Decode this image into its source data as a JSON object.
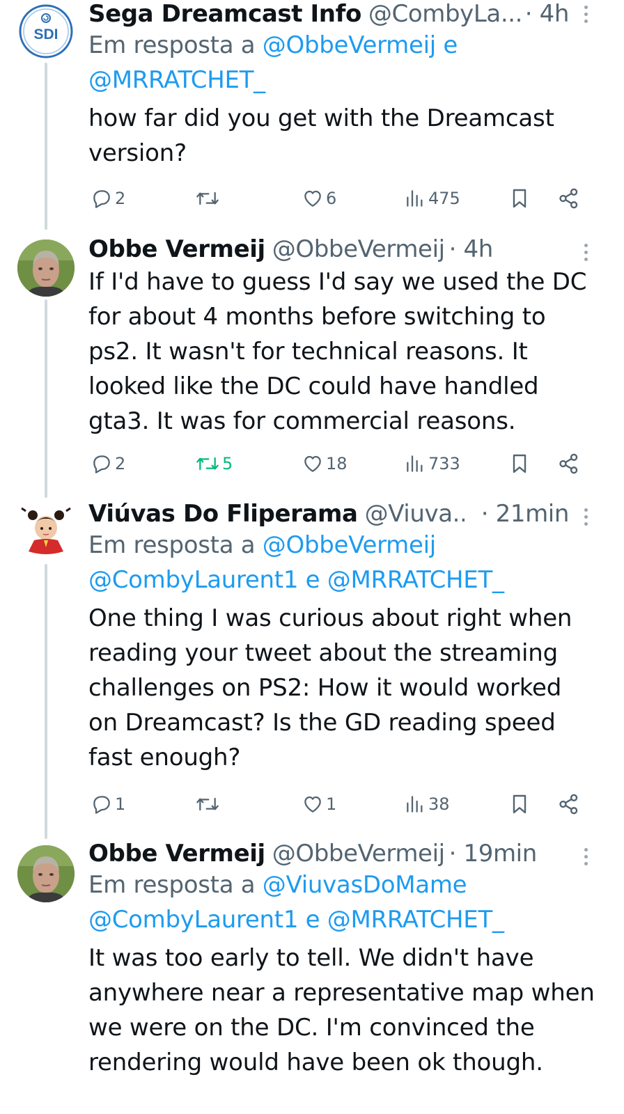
{
  "tweets": [
    {
      "name": "Sega Dreamcast Info",
      "handle": "@CombyLa...",
      "time": "· 4h",
      "avatar": "sdi-logo",
      "reply_prefix": "Em resposta a ",
      "reply_mention_1": "@ObbeVermeij",
      "reply_sep_1": " e",
      "reply_mention_2": "@MRRATCHET_",
      "reply_sep_2": "",
      "reply_mention_3": "",
      "text": "how far did you get with the Dreamcast\nversion?",
      "replies": "2",
      "retweets": "",
      "likes": "6",
      "views": "475"
    },
    {
      "name": "Obbe Vermeij",
      "handle": "@ObbeVermeij",
      "time": "· 4h",
      "avatar": "obbe-photo",
      "text": "If I'd have to guess I'd say we used the DC\nfor about 4 months before switching to\nps2. It wasn't for technical reasons. It\nlooked like the DC could have handled\ngta3. It was for commercial reasons.",
      "replies": "2",
      "retweets": "5",
      "likes": "18",
      "views": "733"
    },
    {
      "name": "Viúvas Do Fliperama",
      "handle": "@Viuva...",
      "time": "· 21min",
      "avatar": "chun-li-avatar",
      "reply_prefix": "Em resposta a ",
      "reply_mention_1": "@ObbeVermeij",
      "reply_mention_2": "@CombyLaurent1",
      "reply_sep_2": " e ",
      "reply_mention_3": "@MRRATCHET_",
      "text": "One thing I was curious about right when\nreading your tweet about the streaming\nchallenges on PS2: How it would worked\non Dreamcast? Is the GD reading speed\nfast enough?",
      "replies": "1",
      "retweets": "",
      "likes": "1",
      "views": "38"
    },
    {
      "name": "Obbe Vermeij",
      "handle": "@ObbeVermeij",
      "time": "· 19min",
      "avatar": "obbe-photo",
      "reply_prefix": "Em resposta a ",
      "reply_mention_1": "@ViuvasDoMame",
      "reply_mention_2": "@CombyLaurent1",
      "reply_sep_2": " e ",
      "reply_mention_3": "@MRRATCHET_",
      "text": "It was too early to tell. We didn't have\nanywhere near a representative map when\nwe were on the DC. I'm convinced the\nrendering would have been ok though."
    }
  ],
  "colors": {
    "text": "#0f1419",
    "muted": "#536471",
    "link": "#1d9bf0",
    "retweet_active": "#00ba7c",
    "thread_line": "#cfd9de"
  },
  "sdi_logo_text": "SDI"
}
